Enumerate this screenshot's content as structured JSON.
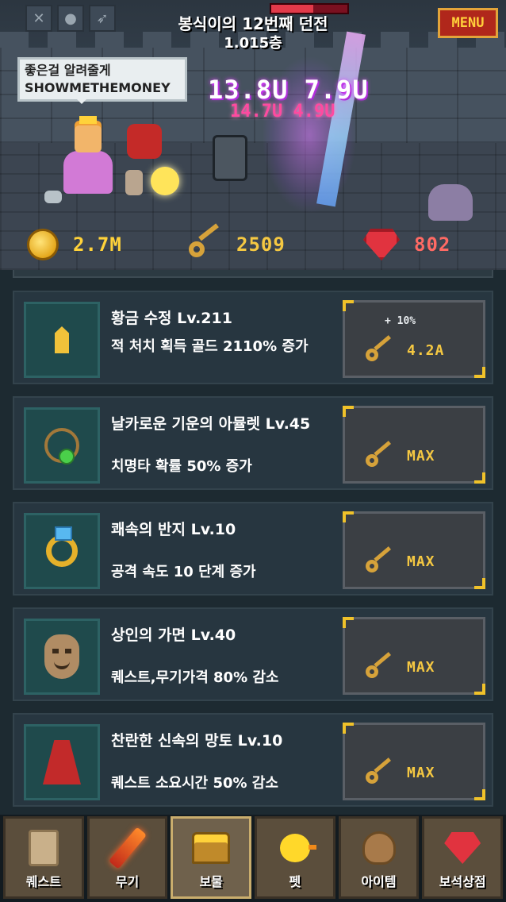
{
  "scene": {
    "dungeon_title": "봉식이의 12번째 던전",
    "dungeon_floor": "1.015층",
    "menu_label": "MENU",
    "speech_line1": "좋은걸 알려줄게",
    "speech_line2": "SHOWMETHEMONEY",
    "damage_main": "13.8U 7.9U",
    "damage_sub": "14.7U 4.9U",
    "boss_hp_percent": 55,
    "top_icons": [
      "crossed-swords-icon",
      "coin-stack-icon",
      "dash-icon"
    ]
  },
  "currency": {
    "gold": "2.7M",
    "keys": "2509",
    "rubies": "802"
  },
  "items": [
    {
      "icon": "golden-crystal-icon",
      "title": "황금 수정 Lv.211",
      "desc": "적 처치 획득 골드 2110% 증가",
      "bonus": "+ 10%",
      "price": "4.2A"
    },
    {
      "icon": "amulet-icon",
      "title": "날카로운 기운의 아뮬렛 Lv.45",
      "desc": "치명타 확률 50% 증가",
      "bonus": "",
      "price": "MAX"
    },
    {
      "icon": "ring-icon",
      "title": "쾌속의 반지 Lv.10",
      "desc": "공격 속도 10 단계 증가",
      "bonus": "",
      "price": "MAX"
    },
    {
      "icon": "mask-icon",
      "title": "상인의 가면 Lv.40",
      "desc": "퀘스트,무기가격 80% 감소",
      "bonus": "",
      "price": "MAX"
    },
    {
      "icon": "cape-icon",
      "title": "찬란한 신속의 망토 Lv.10",
      "desc": "퀘스트 소요시간 50% 감소",
      "bonus": "",
      "price": "MAX"
    }
  ],
  "tabs": [
    {
      "label": "퀘스트",
      "icon": "scroll-icon",
      "active": false
    },
    {
      "label": "무기",
      "icon": "flame-sword-icon",
      "active": false
    },
    {
      "label": "보물",
      "icon": "treasure-chest-icon",
      "active": true
    },
    {
      "label": "펫",
      "icon": "chick-icon",
      "active": false
    },
    {
      "label": "아이템",
      "icon": "sack-icon",
      "active": false
    },
    {
      "label": "보석상점",
      "icon": "ruby-icon",
      "active": false
    }
  ],
  "colors": {
    "gold": "#ffd23a",
    "key": "#f5c842",
    "ruby": "#ff6a64",
    "menu_bg": "#b0271b",
    "panel": "#273640"
  }
}
